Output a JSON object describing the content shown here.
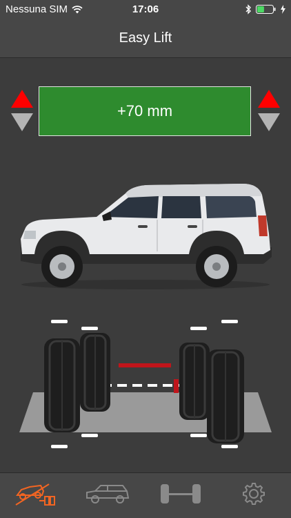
{
  "status": {
    "carrier": "Nessuna SIM",
    "time": "17:06",
    "battery_level": 0.45
  },
  "nav": {
    "title": "Easy Lift"
  },
  "lift": {
    "value_display": "+70 mm",
    "display_color": "#2e8b2e",
    "up_color": "#ff0000",
    "down_color": "#b4b4b4"
  },
  "tabs": [
    {
      "icon": "vehicle-lift-icon",
      "active": true
    },
    {
      "icon": "vehicle-icon",
      "active": false
    },
    {
      "icon": "axle-icon",
      "active": false
    },
    {
      "icon": "settings-gear-icon",
      "active": false
    }
  ],
  "colors": {
    "accent": "#f26522",
    "inactive_tab": "#8a8a8a"
  }
}
